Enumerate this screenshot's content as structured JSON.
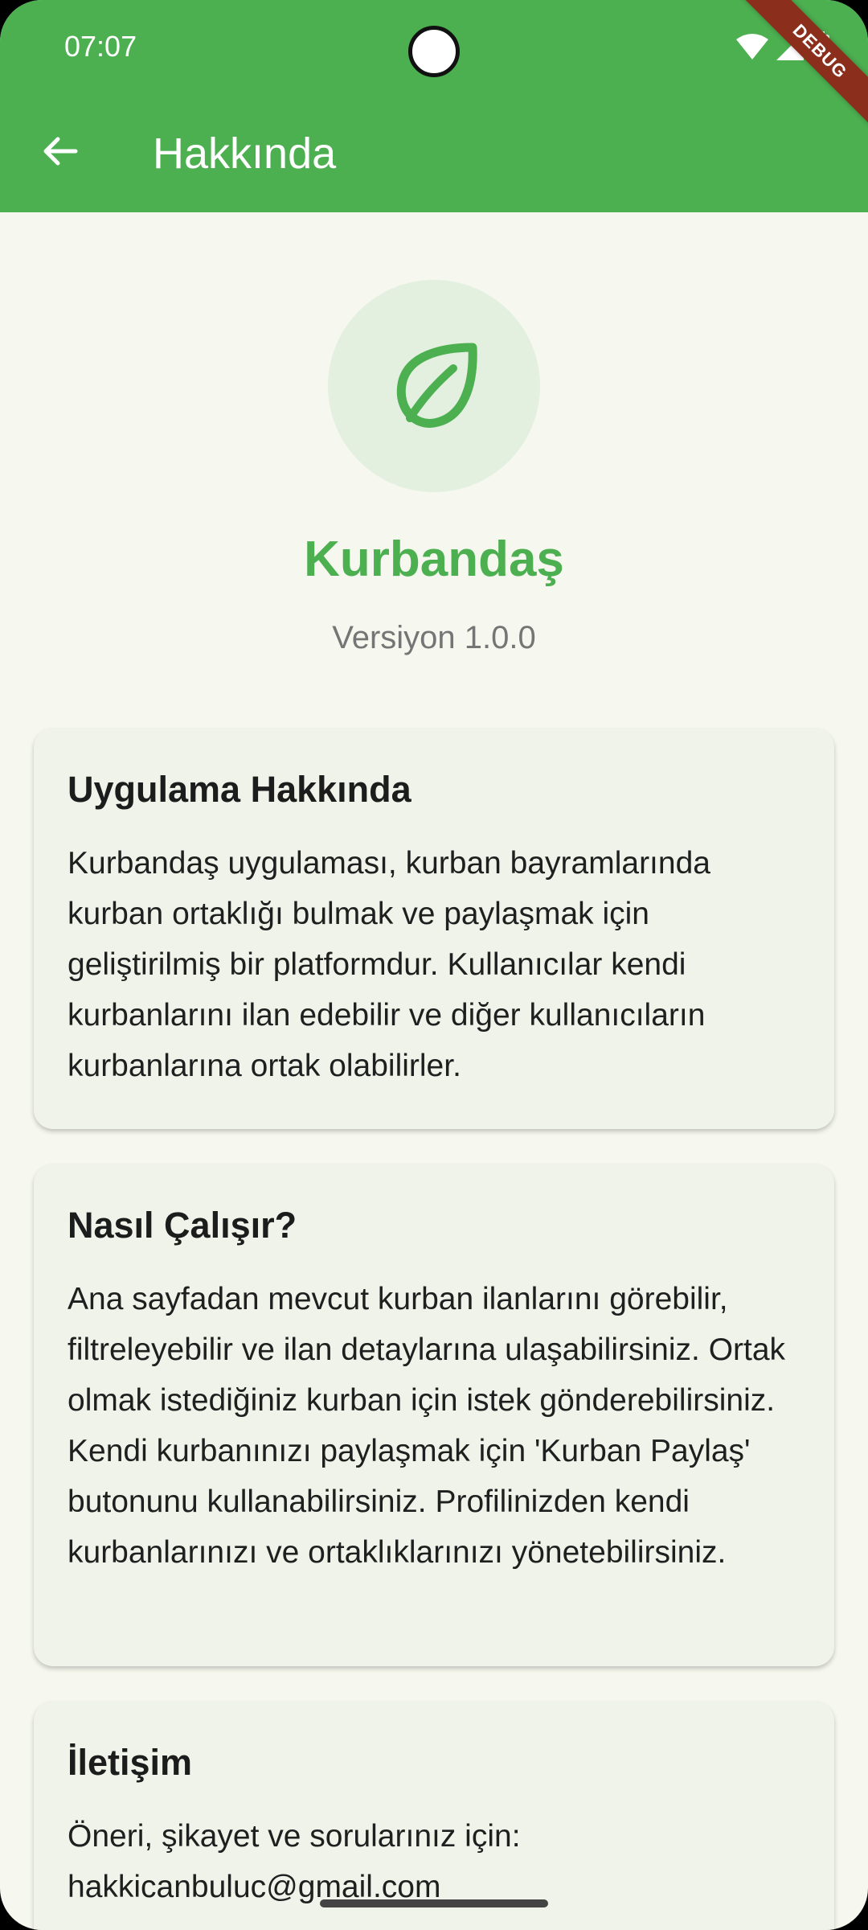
{
  "status_bar": {
    "time": "07:07"
  },
  "debug_banner": "DEBUG",
  "app_bar": {
    "title": "Hakkında",
    "back_icon": "arrow-back-icon"
  },
  "app_info": {
    "logo_icon": "leaf-icon",
    "name": "Kurbandaş",
    "version": "Versiyon 1.0.0"
  },
  "cards": {
    "about": {
      "title": "Uygulama Hakkında",
      "body": "Kurbandaş uygulaması, kurban bayramlarında kurban ortaklığı bulmak ve paylaşmak için geliştirilmiş bir platformdur. Kullanıcılar kendi kurbanlarını ilan edebilir ve diğer kullanıcıların kurbanlarına ortak olabilirler."
    },
    "how": {
      "title": "Nasıl Çalışır?",
      "body": "Ana sayfadan mevcut kurban ilanlarını görebilir, filtreleyebilir ve ilan detaylarına ulaşabilirsiniz. Ortak olmak istediğiniz kurban için istek gönderebilirsiniz. Kendi kurbanınızı paylaşmak için 'Kurban Paylaş' butonunu kullanabilirsiniz. Profilinizden kendi kurbanlarınızı ve ortaklıklarınızı yönetebilirsiniz."
    },
    "contact": {
      "title": "İletişim",
      "body": "Öneri, şikayet ve sorularınız için:",
      "email": "hakkicanbuluc@gmail.com"
    }
  },
  "colors": {
    "primary": "#4caf50",
    "background": "#f6f8ef",
    "card": "#f0f3ea",
    "logo_circle": "#e3f0e0"
  }
}
